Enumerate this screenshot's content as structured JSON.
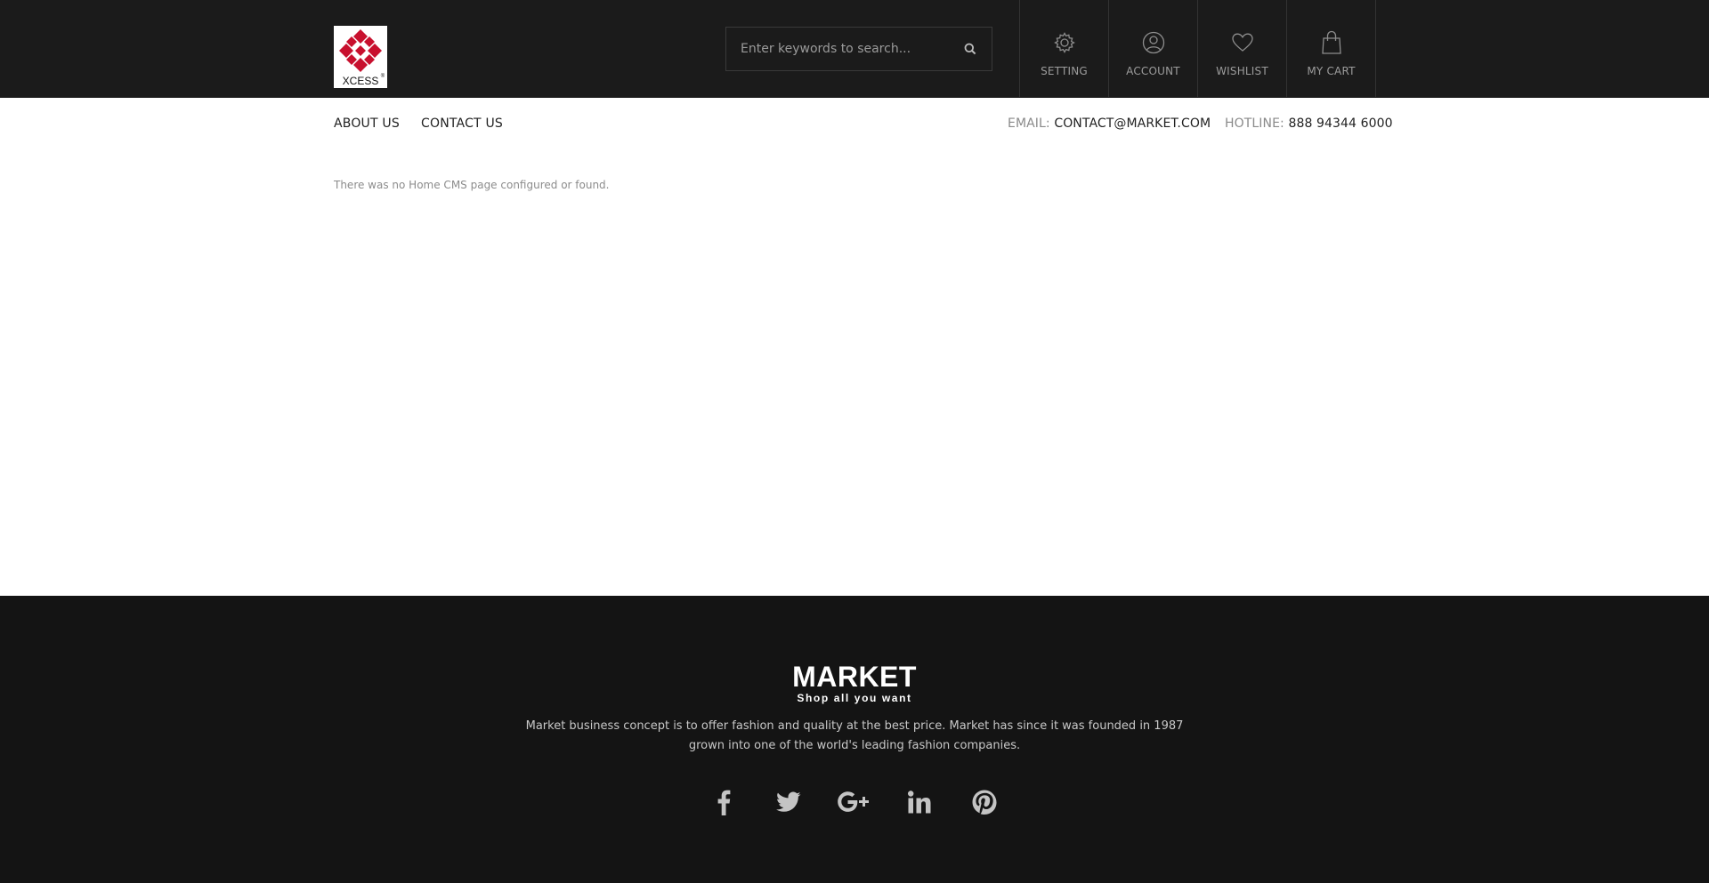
{
  "header": {
    "logo_text": "XCESS",
    "search": {
      "placeholder": "Enter keywords to search..."
    },
    "nav": [
      {
        "label": "SETTING",
        "icon": "gear-icon"
      },
      {
        "label": "ACCOUNT",
        "icon": "user-icon"
      },
      {
        "label": "WISHLIST",
        "icon": "heart-icon"
      },
      {
        "label": "MY CART",
        "icon": "shopping-bag-icon"
      }
    ]
  },
  "subnav": {
    "links": [
      "ABOUT US",
      "CONTACT US"
    ],
    "email_label": "EMAIL:",
    "email_value": "CONTACT@MARKET.COM",
    "hotline_label": "HOTLINE:",
    "hotline_value": "888 94344 6000"
  },
  "main": {
    "message": "There was no Home CMS page configured or found."
  },
  "footer": {
    "brand": "MARKET",
    "tagline": "Shop all you want",
    "description_line1": "Market business concept is to offer fashion and quality at the best price. Market has since it was founded in 1987",
    "description_line2": "grown into one of the world's leading fashion companies.",
    "social": [
      "facebook-icon",
      "twitter-icon",
      "google-plus-icon",
      "linkedin-icon",
      "pinterest-icon"
    ]
  },
  "colors": {
    "header_bg": "#1b1b1b",
    "footer_bg": "#141414",
    "logo_red": "#c8102e"
  }
}
